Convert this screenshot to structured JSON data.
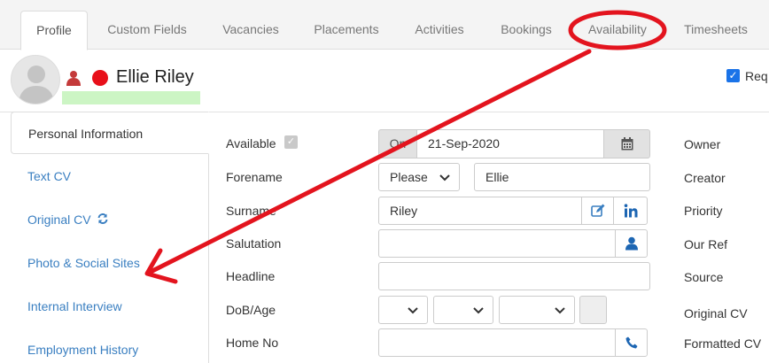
{
  "tabs": [
    {
      "label": "Profile",
      "active": true
    },
    {
      "label": "Custom Fields"
    },
    {
      "label": "Vacancies"
    },
    {
      "label": "Placements"
    },
    {
      "label": "Activities"
    },
    {
      "label": "Bookings"
    },
    {
      "label": "Availability"
    },
    {
      "label": "Timesheets"
    }
  ],
  "header": {
    "candidate_name": "Ellie Riley",
    "status_color": "#e8101a",
    "req_label": "Req"
  },
  "side_menu": [
    {
      "label": "Personal Information",
      "active": true
    },
    {
      "label": "Text CV"
    },
    {
      "label": "Original CV"
    },
    {
      "label": "Photo & Social Sites"
    },
    {
      "label": "Internal Interview"
    },
    {
      "label": "Employment History"
    }
  ],
  "form": {
    "available_label": "Available",
    "available_on_label": "On",
    "available_date": "21-Sep-2020",
    "forename_label": "Forename",
    "forename_select": "Please",
    "forename_value": "Ellie",
    "surname_label": "Surname",
    "surname_value": "Riley",
    "salutation_label": "Salutation",
    "headline_label": "Headline",
    "dob_label": "DoB/Age",
    "home_no_label": "Home No"
  },
  "right_labels": {
    "owner": "Owner",
    "creator": "Creator",
    "priority": "Priority",
    "our_ref": "Our Ref",
    "source": "Source",
    "original_cv": "Original CV",
    "formatted_cv": "Formatted CV"
  },
  "colors": {
    "link": "#3a7fc1",
    "annotation": "#e3141e",
    "accent": "#1a73e8"
  }
}
